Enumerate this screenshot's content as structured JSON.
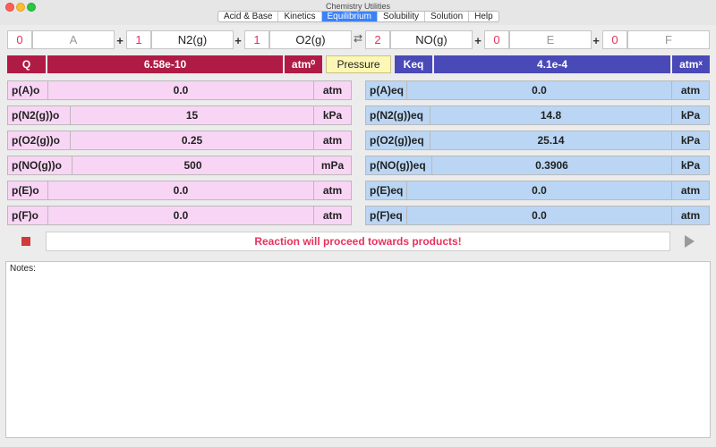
{
  "window": {
    "title": "Chemistry Utilities"
  },
  "tabs": [
    {
      "label": "Acid & Base",
      "active": false
    },
    {
      "label": "Kinetics",
      "active": false
    },
    {
      "label": "Equilibrium",
      "active": true
    },
    {
      "label": "Solubility",
      "active": false
    },
    {
      "label": "Solution",
      "active": false
    },
    {
      "label": "Help",
      "active": false
    }
  ],
  "equation": {
    "reactants": [
      {
        "coef": "0",
        "species": "A"
      },
      {
        "coef": "1",
        "species": "N2(g)"
      },
      {
        "coef": "1",
        "species": "O2(g)"
      }
    ],
    "products": [
      {
        "coef": "2",
        "species": "NO(g)"
      },
      {
        "coef": "0",
        "species": "E"
      },
      {
        "coef": "0",
        "species": "F"
      }
    ],
    "plus": "+",
    "arrow": "⇄"
  },
  "q_row": {
    "q_label": "Q",
    "q_value": "6.58e-10",
    "q_unit": "atm⁰",
    "mode": "Pressure",
    "keq_label": "Keq",
    "keq_value": "4.1e-4",
    "keq_unit": "atmˣ"
  },
  "initial": [
    {
      "label": "p(A)o",
      "value": "0.0",
      "unit": "atm"
    },
    {
      "label": "p(N2(g))o",
      "value": "15",
      "unit": "kPa"
    },
    {
      "label": "p(O2(g))o",
      "value": "0.25",
      "unit": "atm"
    },
    {
      "label": "p(NO(g))o",
      "value": "500",
      "unit": "mPa"
    },
    {
      "label": "p(E)o",
      "value": "0.0",
      "unit": "atm"
    },
    {
      "label": "p(F)o",
      "value": "0.0",
      "unit": "atm"
    }
  ],
  "equilibrium": [
    {
      "label": "p(A)eq",
      "value": "0.0",
      "unit": "atm"
    },
    {
      "label": "p(N2(g))eq",
      "value": "14.8",
      "unit": "kPa"
    },
    {
      "label": "p(O2(g))eq",
      "value": "25.14",
      "unit": "kPa"
    },
    {
      "label": "p(NO(g))eq",
      "value": "0.3906",
      "unit": "kPa"
    },
    {
      "label": "p(E)eq",
      "value": "0.0",
      "unit": "atm"
    },
    {
      "label": "p(F)eq",
      "value": "0.0",
      "unit": "atm"
    }
  ],
  "status": {
    "message": "Reaction will proceed towards products!"
  },
  "notes": {
    "label": "Notes:",
    "text": ""
  },
  "icons": {
    "stop": "stop-icon",
    "play": "play-icon"
  },
  "colors": {
    "q_accent": "#b01b45",
    "keq_accent": "#4a49b8",
    "message": "#e8325c",
    "coef": "#e5325c",
    "initial_bg": "#f9d5f5",
    "equilibrium_bg": "#bad6f4",
    "pressure_bg": "#fdf7b5"
  }
}
